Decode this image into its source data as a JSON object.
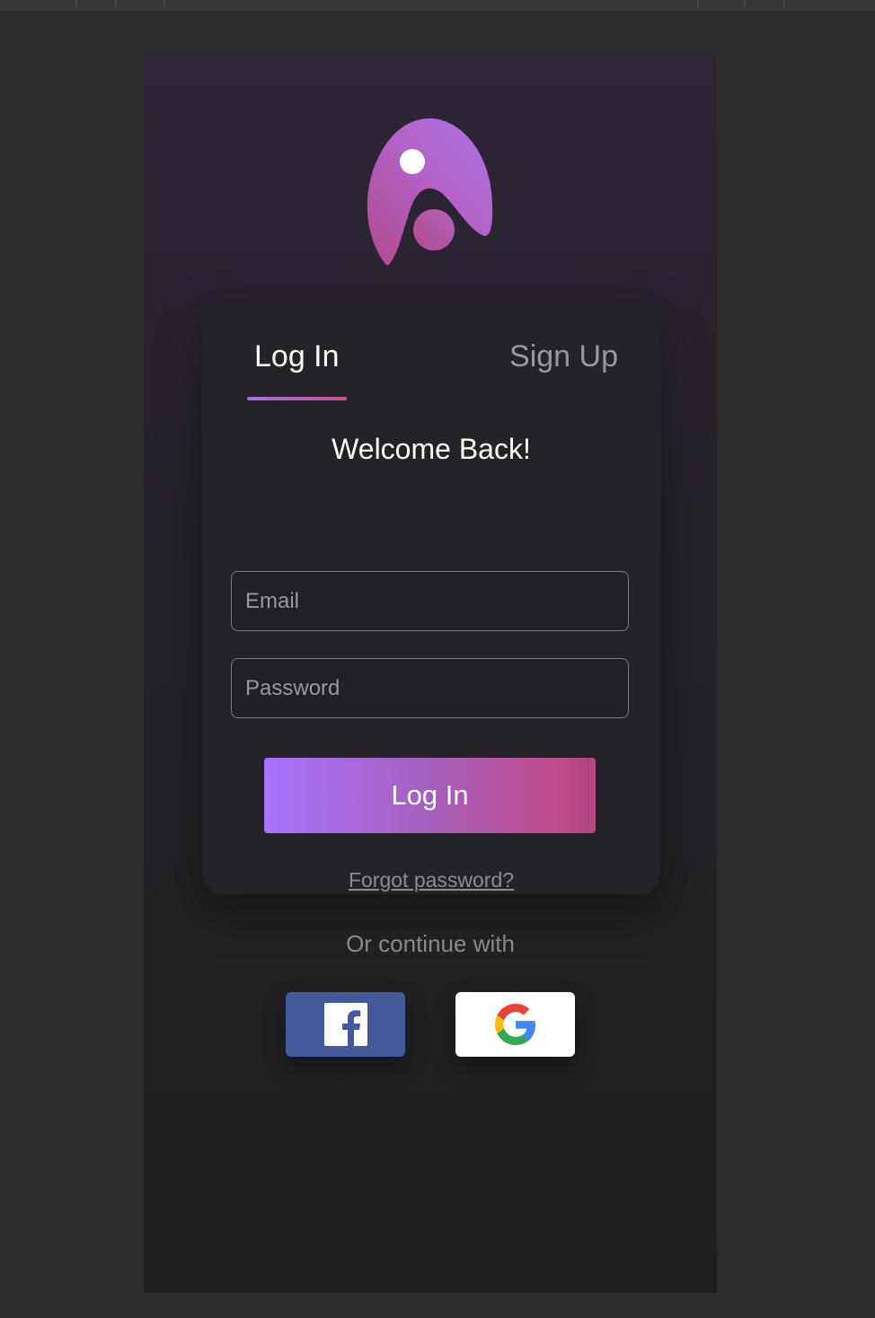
{
  "tabs": {
    "login": "Log In",
    "signup": "Sign Up"
  },
  "form": {
    "heading": "Welcome Back!",
    "email_placeholder": "Email",
    "password_placeholder": "Password",
    "submit_label": "Log In",
    "forgot_label": "Forgot password?"
  },
  "social": {
    "divider_text": "Or continue with",
    "buttons": [
      {
        "icon": "facebook-icon"
      },
      {
        "icon": "google-icon"
      }
    ]
  },
  "colors": {
    "page_background": "#2c2c2c",
    "accent_start": "#a872ff",
    "accent_end": "#c04d8c",
    "facebook_blue": "#44599a"
  }
}
